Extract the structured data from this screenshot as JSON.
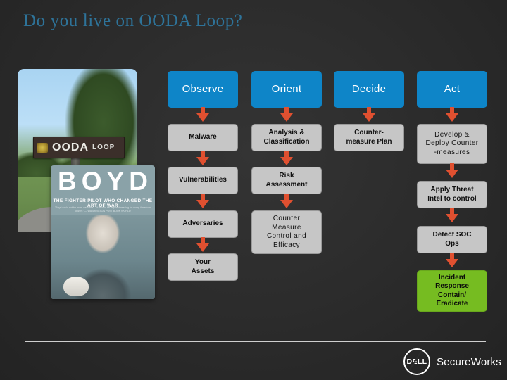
{
  "slide": {
    "title": "Do you live on OODA Loop?",
    "background_color": "#2c2c2c",
    "title_color": "#2e7399"
  },
  "imagery": {
    "street_sign": {
      "name": "ooda-loop-street-sign-photo",
      "sign_primary": "OODA",
      "sign_secondary": "LOOP"
    },
    "book_cover": {
      "name": "boyd-book-cover-photo",
      "title": "BOYD",
      "subtitle": "THE FIGHTER PILOT WHO CHANGED THE ART OF WAR",
      "quote": "\"Boyd could not be more welcome ... It should be required reading for every American citizen.\" — WASHINGTON POST BOOK WORLD"
    }
  },
  "colors": {
    "header_blue": "#0e85c8",
    "box_gray": "#c6c6c6",
    "box_green": "#76bc21",
    "arrow_orange": "#e05030"
  },
  "flow": {
    "columns": [
      {
        "id": "observe",
        "header": "Observe",
        "steps": [
          {
            "label": "Malware",
            "style": "gray"
          },
          {
            "label": "Vulnerabilities",
            "style": "gray"
          },
          {
            "label": "Adversaries",
            "style": "gray"
          },
          {
            "label": "Your\nAssets",
            "style": "gray"
          }
        ]
      },
      {
        "id": "orient",
        "header": "Orient",
        "steps": [
          {
            "label": "Analysis &\nClassification",
            "style": "gray"
          },
          {
            "label": "Risk\nAssessment",
            "style": "gray"
          },
          {
            "label": "Counter\nMeasure\nControl and\nEfficacy",
            "style": "gray-thin"
          }
        ]
      },
      {
        "id": "decide",
        "header": "Decide",
        "steps": [
          {
            "label": "Counter-\nmeasure Plan",
            "style": "gray"
          }
        ]
      },
      {
        "id": "act",
        "header": "Act",
        "steps": [
          {
            "label": "Develop &\nDeploy Counter\n-measures",
            "style": "gray-thin"
          },
          {
            "label": "Apply Threat\nIntel to control",
            "style": "gray"
          },
          {
            "label": "Detect SOC\nOps",
            "style": "gray"
          },
          {
            "label": "Incident\nResponse\nContain/\nEradicate",
            "style": "green"
          }
        ]
      }
    ]
  },
  "footer": {
    "logo_mark": "DELL",
    "logo_text": "SecureWorks"
  }
}
